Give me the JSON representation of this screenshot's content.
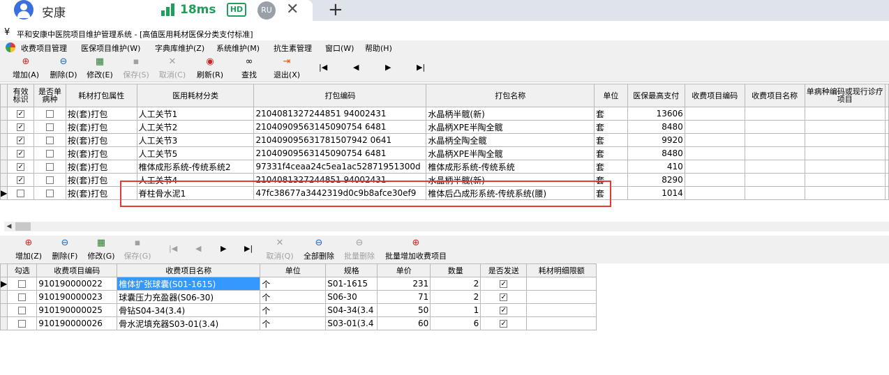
{
  "tabbar": {
    "tab_name": "安康",
    "latency": "18ms",
    "hd": "HD",
    "ru": "RU"
  },
  "window": {
    "title": "平和安康中医院项目维护管理系统 - [高值医用耗材医保分类支付标准]"
  },
  "menu": [
    "收费项目管理",
    "医保项目维护(W)",
    "字典库维护(Z)",
    "系统维护(M)",
    "抗生素管理",
    "窗口(W)",
    "帮助(H)"
  ],
  "toolbar1": {
    "add": "增加(A)",
    "delete": "删除(D)",
    "edit": "修改(E)",
    "save": "保存(S)",
    "cancel": "取消(C)",
    "refresh": "刷新(R)",
    "find": "查找",
    "exit": "退出(X)"
  },
  "grid1": {
    "headers": [
      "有效标识",
      "是否单病种",
      "耗材打包属性",
      "医用耗材分类",
      "打包编码",
      "打包名称",
      "单位",
      "医保最高支付",
      "收费项目编码",
      "收费项目名称",
      "单病种编码或现行诊疗项目"
    ],
    "rows": [
      {
        "attr": "按(套)打包",
        "category": "人工关节1",
        "code": "2104081327244851 94002431",
        "name": "水晶柄半髋(新)",
        "unit": "套",
        "max_pay": "13606",
        "valid": true,
        "single": false
      },
      {
        "attr": "按(套)打包",
        "category": "人工关节2",
        "code": "21040909563145090754 6481",
        "name": "水晶柄XPE半陶全髋",
        "unit": "套",
        "max_pay": "8480",
        "valid": true,
        "single": false
      },
      {
        "attr": "按(套)打包",
        "category": "人工关节3",
        "code": "210409095631781507942 0641",
        "name": "水晶柄全陶全髋",
        "unit": "套",
        "max_pay": "9920",
        "valid": true,
        "single": false
      },
      {
        "attr": "按(套)打包",
        "category": "人工关节5",
        "code": "21040909563145090754 6481",
        "name": "水晶柄XPE半陶全髋",
        "unit": "套",
        "max_pay": "8480",
        "valid": true,
        "single": false
      },
      {
        "attr": "按(套)打包",
        "category": "椎体成形系统-传统系统2",
        "code": "97331f4ceaa24c5ea1ac52871951300d",
        "name": "椎体成形系统-传统系统",
        "unit": "套",
        "max_pay": "410",
        "valid": true,
        "single": false
      },
      {
        "attr": "按(套)打包",
        "category": "人工关节4",
        "code": "2104081327244851 94002431",
        "name": "水晶柄半髋(新)",
        "unit": "套",
        "max_pay": "8290",
        "valid": true,
        "single": false
      },
      {
        "attr": "按(套)打包",
        "category": "脊柱骨水泥1",
        "code": "47fc38677a3442319d0c9b8afce30ef9",
        "name": "椎体后凸成形系统-传统系统(腰)",
        "unit": "套",
        "max_pay": "1014",
        "valid": false,
        "single": false
      }
    ]
  },
  "toolbar2": {
    "add": "增加(Z)",
    "delete": "删除(F)",
    "edit": "修改(G)",
    "save": "保存(G)",
    "cancel": "取消(Q)",
    "delete_all": "全部删除",
    "batch_delete": "批量删除",
    "batch_add": "批量增加收费项目"
  },
  "grid2": {
    "headers": [
      "勾选",
      "收费项目编码",
      "收费项目名称",
      "单位",
      "规格",
      "单价",
      "数量",
      "是否发送",
      "耗材明细限额"
    ],
    "rows": [
      {
        "code": "910190000022",
        "name": "椎体扩张球囊(S01-1615)",
        "unit": "个",
        "spec": "S01-1615",
        "price": "231",
        "qty": "2",
        "sent": true
      },
      {
        "code": "910190000023",
        "name": "球囊压力充盈器(S06-30)",
        "unit": "个",
        "spec": "S06-30",
        "price": "71",
        "qty": "2",
        "sent": true
      },
      {
        "code": "910190000025",
        "name": "骨钻S04-34(3.4)",
        "unit": "个",
        "spec": "S04-34(3.4",
        "price": "50",
        "qty": "1",
        "sent": true
      },
      {
        "code": "910190000026",
        "name": "骨水泥填充器S03-01(3.4)",
        "unit": "个",
        "spec": "S03-01(3.4",
        "price": "60",
        "qty": "6",
        "sent": true
      }
    ]
  }
}
